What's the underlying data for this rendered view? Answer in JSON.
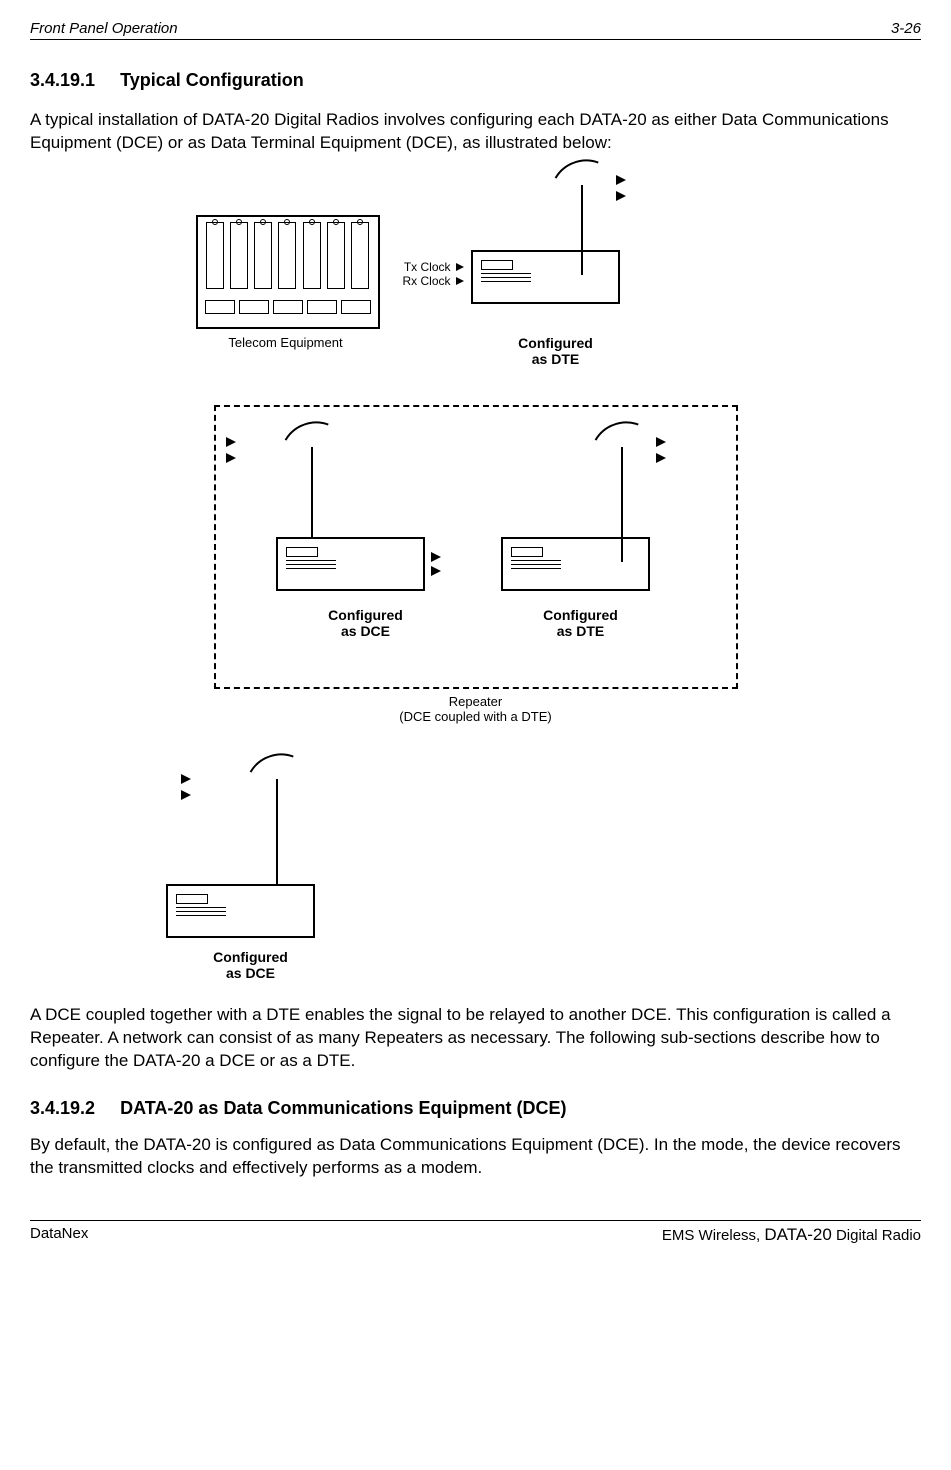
{
  "header": {
    "left": "Front Panel Operation",
    "right": "3-26"
  },
  "section1": {
    "number": "3.4.19.1",
    "title": "Typical Configuration",
    "paragraph": "A typical installation of DATA-20 Digital Radios involves configuring each DATA-20 as either Data Communications Equipment (DCE) or as Data Terminal Equipment (DCE), as illustrated below:"
  },
  "diagram": {
    "telecom_label": "Telecom Equipment",
    "tx_clock": "Tx Clock",
    "rx_clock": "Rx Clock",
    "configured_as_dte": "Configured\nas DTE",
    "configured_as_dce": "Configured\nas DCE",
    "repeater_label": "Repeater",
    "repeater_sub": "(DCE coupled with a DTE)"
  },
  "paragraph2": "A DCE coupled together with a DTE enables the signal to be relayed to another DCE. This configuration is called a Repeater.  A network can consist of as many Repeaters as necessary.  The following sub-sections describe how to configure the DATA-20 a DCE or as a DTE.",
  "section2": {
    "number": "3.4.19.2",
    "title": "DATA-20 as Data Communications Equipment (DCE)",
    "paragraph": "By default, the DATA-20 is configured as Data Communications Equipment (DCE).  In the mode, the device recovers the transmitted clocks and effectively performs as a modem."
  },
  "footer": {
    "left": "DataNex",
    "right_company": "EMS Wireless, ",
    "right_product": "DATA-20",
    "right_suffix": " Digital Radio"
  }
}
